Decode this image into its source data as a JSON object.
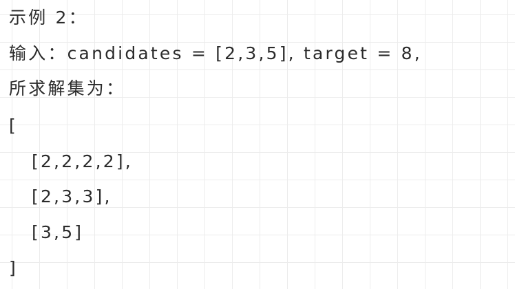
{
  "document": {
    "example_heading": "示例 2：",
    "input_line": "输入：candidates = [2,3,5], target = 8,",
    "solution_label": "所求解集为：",
    "open_bracket": "[",
    "solutions": [
      "[2,2,2,2],",
      "[2,3,3],",
      "[3,5]"
    ],
    "close_bracket": "]"
  }
}
